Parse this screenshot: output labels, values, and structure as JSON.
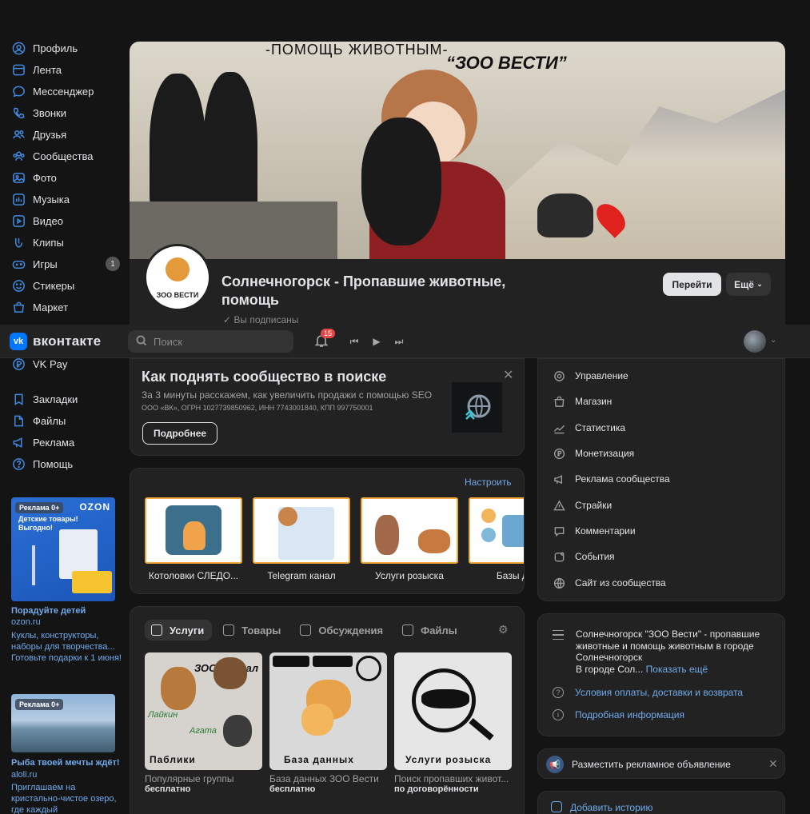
{
  "sidebar": {
    "items": [
      {
        "label": "Профиль",
        "icon": "user-circle-icon"
      },
      {
        "label": "Лента",
        "icon": "news-icon"
      },
      {
        "label": "Мессенджер",
        "icon": "message-icon"
      },
      {
        "label": "Звонки",
        "icon": "phone-icon"
      },
      {
        "label": "Друзья",
        "icon": "friends-icon"
      },
      {
        "label": "Сообщества",
        "icon": "community-icon"
      },
      {
        "label": "Фото",
        "icon": "photo-icon"
      },
      {
        "label": "Музыка",
        "icon": "music-icon"
      },
      {
        "label": "Видео",
        "icon": "video-icon"
      },
      {
        "label": "Клипы",
        "icon": "clips-icon"
      },
      {
        "label": "Игры",
        "icon": "game-icon",
        "badge": "1"
      },
      {
        "label": "Стикеры",
        "icon": "sticker-icon"
      },
      {
        "label": "Маркет",
        "icon": "market-icon"
      },
      {
        "label": "VK Pay",
        "icon": "vkpay-icon"
      },
      {
        "label": "Закладки",
        "icon": "bookmark-icon"
      },
      {
        "label": "Файлы",
        "icon": "file-icon"
      },
      {
        "label": "Реклама",
        "icon": "megaphone-icon"
      },
      {
        "label": "Помощь",
        "icon": "help-icon"
      }
    ]
  },
  "header": {
    "brand": "вконтакте",
    "logo_mark": "vk",
    "search_placeholder": "Поиск",
    "notifications_count": "15"
  },
  "cover": {
    "line1": "-ПОМОЩЬ ЖИВОТНЫМ-",
    "line2": "“ЗОО ВЕСТИ”"
  },
  "group": {
    "avatar_text": "ЗОО ВЕСТИ",
    "name": "Солнечногорск - Пропавшие животные, помощь",
    "subscribed": "Вы подписаны",
    "go_button": "Перейти",
    "more_button": "Ещё"
  },
  "promo": {
    "title": "Как поднять сообщество в поиске",
    "subtitle": "За 3 минуты расскажем, как увеличить продажи с помощью SEO",
    "legal": "ООО «ВК», ОГРН 1027739850962, ИНН 7743001840, КПП 997750001",
    "button": "Подробнее"
  },
  "links": {
    "configure": "Настроить",
    "items": [
      "Котоловки СЛЕДО...",
      "Telegram канал",
      "Услуги розыска",
      "Базы дан"
    ]
  },
  "services": {
    "tabs": [
      "Услуги",
      "Товары",
      "Обсуждения",
      "Файлы"
    ],
    "items": [
      {
        "name": "Популярные группы",
        "price": "бесплатно",
        "label": "Паблики",
        "art1": "ЗОО журнал",
        "art2": "Лайкин",
        "art3": "Агата"
      },
      {
        "name": "База данных ЗОО Вести",
        "price": "бесплатно",
        "label": "База данных"
      },
      {
        "name": "Поиск пропавших живот...",
        "price": "по договорённости",
        "label": "Услуги розыска"
      }
    ]
  },
  "admin_menu": {
    "items": [
      "Управление",
      "Магазин",
      "Статистика",
      "Монетизация",
      "Реклама сообщества",
      "Страйки",
      "Комментарии",
      "События",
      "Сайт из сообщества"
    ]
  },
  "about": {
    "description": "Солнечногорск \"ЗОО Вести\" - пропавшие животные и помощь животным в городе Солнечногорск",
    "more_prefix": "В городе Сол...",
    "show_more": "Показать ещё",
    "payment_link": "Условия оплаты, доставки и возврата",
    "details_link": "Подробная информация"
  },
  "ad_bar": {
    "label": "Разместить рекламное объявление"
  },
  "story": {
    "label": "Добавить историю"
  },
  "ads": [
    {
      "tag": "Реклама 0+",
      "brand": "OZON",
      "banner": "Детские товары! Выгодно!",
      "title": "Порадуйте детей",
      "domain": "ozon.ru",
      "text": "Куклы, конструкторы, наборы для творчества... Готовьте подарки к 1 июня!"
    },
    {
      "tag": "Реклама 0+",
      "title": "Рыба твоей мечты ждёт!",
      "domain": "aloli.ru",
      "text": "Приглашаем на кристально-чистое озеро, где каждый"
    }
  ],
  "colors": {
    "accent": "#3f8ae0",
    "link": "#71aaeb",
    "background": "#141414",
    "panel": "#222222",
    "tile_border": "#f2a93b",
    "vk_blue": "#0077ff"
  }
}
